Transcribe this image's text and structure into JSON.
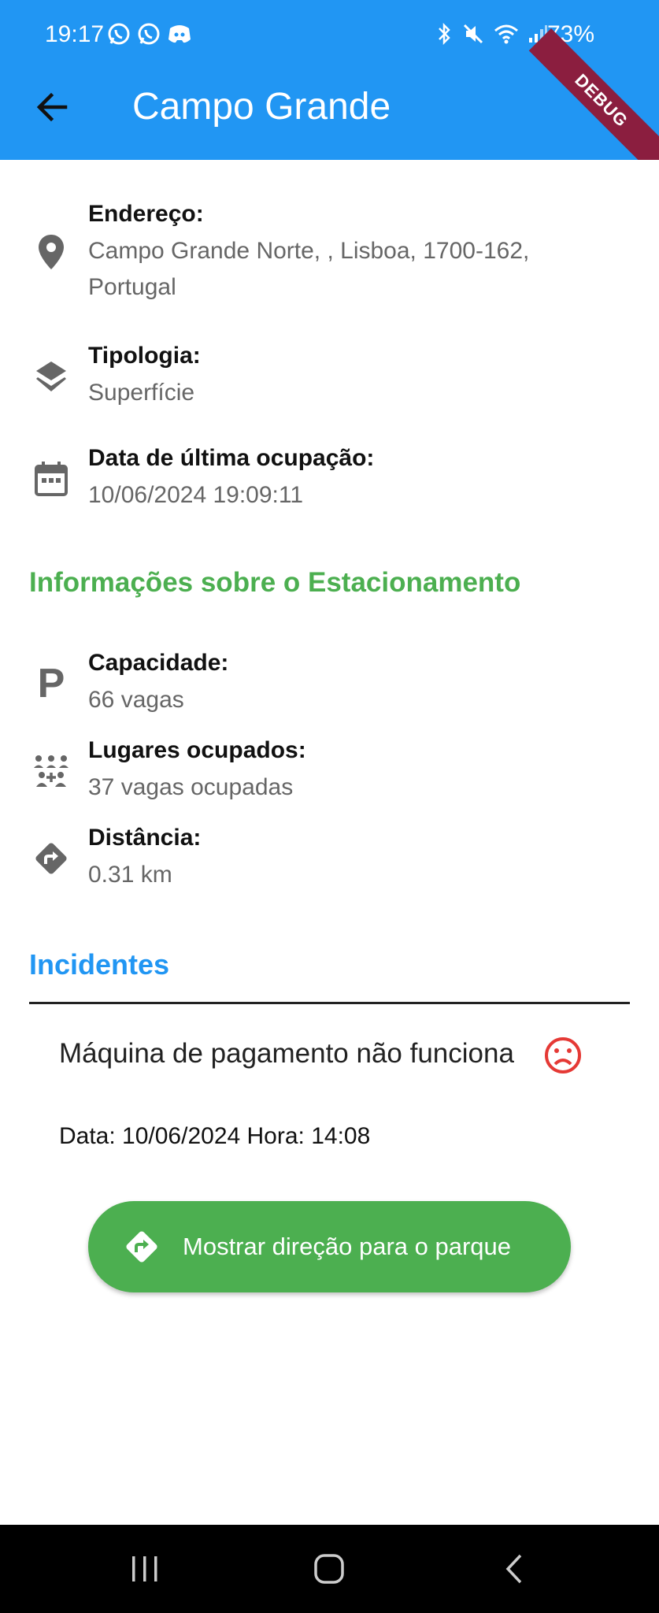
{
  "status_bar": {
    "time": "19:17",
    "battery": "73%",
    "left_icons": [
      "whatsapp-icon",
      "whatsapp-icon",
      "discord-icon"
    ],
    "right_icons": [
      "bluetooth-icon",
      "mute-icon",
      "wifi-icon",
      "signal-icon"
    ]
  },
  "app_bar": {
    "title": "Campo Grande",
    "debug_banner": "DEBUG"
  },
  "details": {
    "address_label": "Endereço:",
    "address_value": "Campo Grande Norte, , Lisboa, 1700-162, Portugal",
    "type_label": "Tipologia:",
    "type_value": "Superfície",
    "last_occ_label": "Data de última ocupação:",
    "last_occ_value": "10/06/2024 19:09:11"
  },
  "parking_info": {
    "section_title": "Informações sobre o Estacionamento",
    "capacity_label": "Capacidade:",
    "capacity_value": "66 vagas",
    "occupied_label": "Lugares ocupados:",
    "occupied_value": "37 vagas ocupadas",
    "distance_label": "Distância:",
    "distance_value": "0.31 km"
  },
  "incidents": {
    "section_title": "Incidentes",
    "items": [
      {
        "title": "Máquina de pagamento não funciona",
        "meta": "Data: 10/06/2024 Hora: 14:08"
      }
    ]
  },
  "actions": {
    "directions_label": "Mostrar direção para o parque"
  },
  "colors": {
    "app_bar": "#2196F3",
    "green": "#4CAF50",
    "blue_section": "#2196F3",
    "sad_red": "#E53935",
    "debug": "#8B1E3F"
  }
}
